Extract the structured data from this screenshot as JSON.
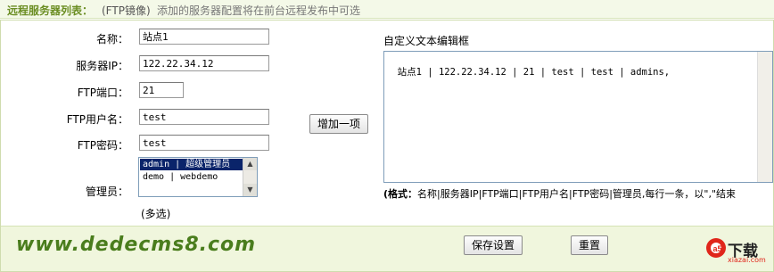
{
  "header": {
    "title": "远程服务器列表：",
    "subtitle_tag": "(FTP镜像)",
    "subtitle": "添加的服务器配置将在前台远程发布中可选"
  },
  "form": {
    "name_label": "名称：",
    "name_value": "站点1",
    "ip_label": "服务器IP：",
    "ip_value": "122.22.34.12",
    "port_label": "FTP端口：",
    "port_value": "21",
    "user_label": "FTP用户名：",
    "user_value": "test",
    "pass_label": "FTP密码：",
    "pass_value": "test",
    "admin_label": "管理员：",
    "admin_options": [
      "admin | 超级管理员",
      "demo | webdemo"
    ],
    "multi_note": "(多选)"
  },
  "add_button": "增加一项",
  "editor": {
    "title": "自定义文本编辑框",
    "content": "站点1 | 122.22.34.12 | 21 | test | test | admins,",
    "format_prefix": "(格式：",
    "format_text": "名称|服务器IP|FTP端口|FTP用户名|FTP密码|管理员,每行一条，以\",\"结束"
  },
  "footer": {
    "site": "www.dedecms8.com",
    "save_button": "保存设置",
    "reset_button": "重置",
    "logo_main": "下载",
    "logo_sub": "xiazai.com",
    "logo_mark": "a5"
  },
  "colors": {
    "accent": "#6b8e23",
    "footer_bg": "#f0f6dd",
    "selection": "#0a246a",
    "logo_red": "#e0261b"
  }
}
